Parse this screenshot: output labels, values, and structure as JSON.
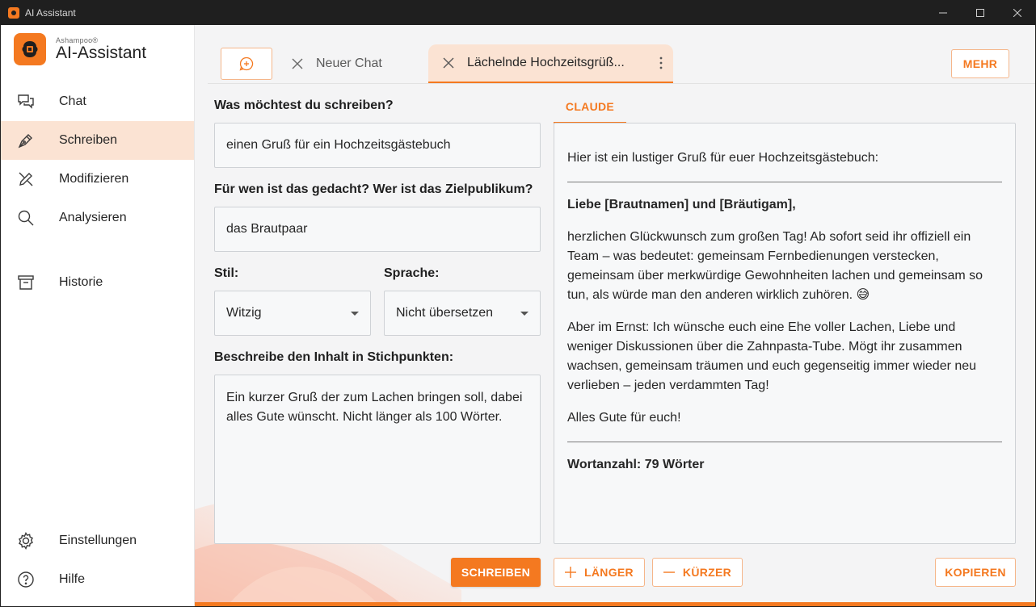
{
  "window": {
    "title": "AI Assistant"
  },
  "brand": {
    "small": "Ashampoo®",
    "name": "AI-Assistant"
  },
  "sidebar": {
    "items": [
      {
        "label": "Chat",
        "icon": "chat-icon"
      },
      {
        "label": "Schreiben",
        "icon": "pen-icon",
        "active": true
      },
      {
        "label": "Modifizieren",
        "icon": "edit-icon"
      },
      {
        "label": "Analysieren",
        "icon": "search-icon"
      },
      {
        "label": "Historie",
        "icon": "archive-icon"
      },
      {
        "label": "Einstellungen",
        "icon": "gear-icon"
      },
      {
        "label": "Hilfe",
        "icon": "help-icon"
      }
    ]
  },
  "tabs": [
    {
      "label": "Neuer Chat"
    },
    {
      "label": "Lächelnde Hochzeitsgrüß..."
    }
  ],
  "toolbar": {
    "mehr_label": "MEHR"
  },
  "form": {
    "q1_label": "Was möchtest du schreiben?",
    "q1_value": "einen Gruß für ein Hochzeitsgästebuch",
    "q2_label": "Für wen ist das gedacht? Wer ist das Zielpublikum?",
    "q2_value": "das Brautpaar",
    "stil_label": "Stil:",
    "stil_value": "Witzig",
    "sprache_label": "Sprache:",
    "sprache_value": "Nicht übersetzen",
    "content_label": "Beschreibe den Inhalt in Stichpunkten:",
    "content_value": "Ein kurzer Gruß der zum Lachen bringen soll, dabei alles Gute wünscht. Nicht länger als 100 Wörter."
  },
  "result": {
    "tab_label": "CLAUDE",
    "intro": "Hier ist ein lustiger Gruß für euer Hochzeitsgästebuch:",
    "salutation": "Liebe [Brautnamen] und [Bräutigam],",
    "paragraph1": "herzlichen Glückwunsch zum großen Tag! Ab sofort seid ihr offiziell ein Team – was bedeutet: gemeinsam Fernbedienungen verstecken, gemeinsam über merkwürdige Gewohnheiten lachen und gemeinsam so tun, als würde man den anderen wirklich zuhören. 😅",
    "paragraph2": "Aber im Ernst: Ich wünsche euch eine Ehe voller Lachen, Liebe und weniger Diskussionen über die Zahnpasta-Tube. Mögt ihr zusammen wachsen, gemeinsam träumen und euch gegenseitig immer wieder neu verlieben – jeden verdammten Tag!",
    "closing": "Alles Gute für euch!",
    "word_count": "Wortanzahl: 79 Wörter"
  },
  "buttons": {
    "write": "SCHREIBEN",
    "longer": "LÄNGER",
    "shorter": "KÜRZER",
    "copy": "KOPIEREN"
  },
  "colors": {
    "accent": "#f47920",
    "accent_light": "#fbe3d3"
  }
}
